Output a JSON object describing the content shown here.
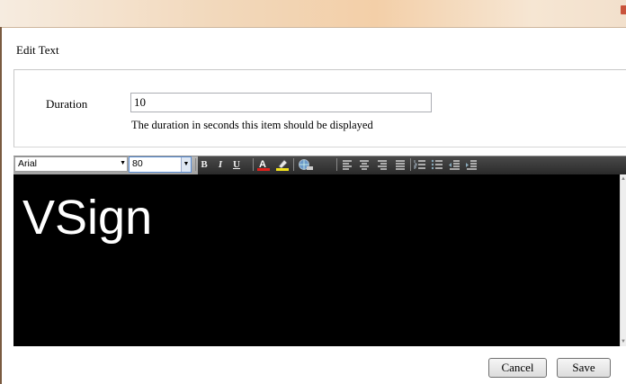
{
  "dialog": {
    "title": "Edit Text"
  },
  "form": {
    "duration_label": "Duration",
    "duration_value": "10",
    "duration_help": "The duration in seconds this item should be displayed"
  },
  "toolbar": {
    "font_name": "Arial",
    "font_size": "80",
    "bold": "B",
    "italic": "I",
    "underline": "U",
    "font_color": "A"
  },
  "editor": {
    "content": "VSign",
    "background": "#000000",
    "text_color": "#ffffff"
  },
  "buttons": {
    "cancel": "Cancel",
    "save": "Save"
  },
  "colors": {
    "titlebar_accent": "#f3cfa8",
    "close_button": "#c9533b",
    "font_color_bar": "#e0201c",
    "highlight_bar": "#f2e21c"
  }
}
